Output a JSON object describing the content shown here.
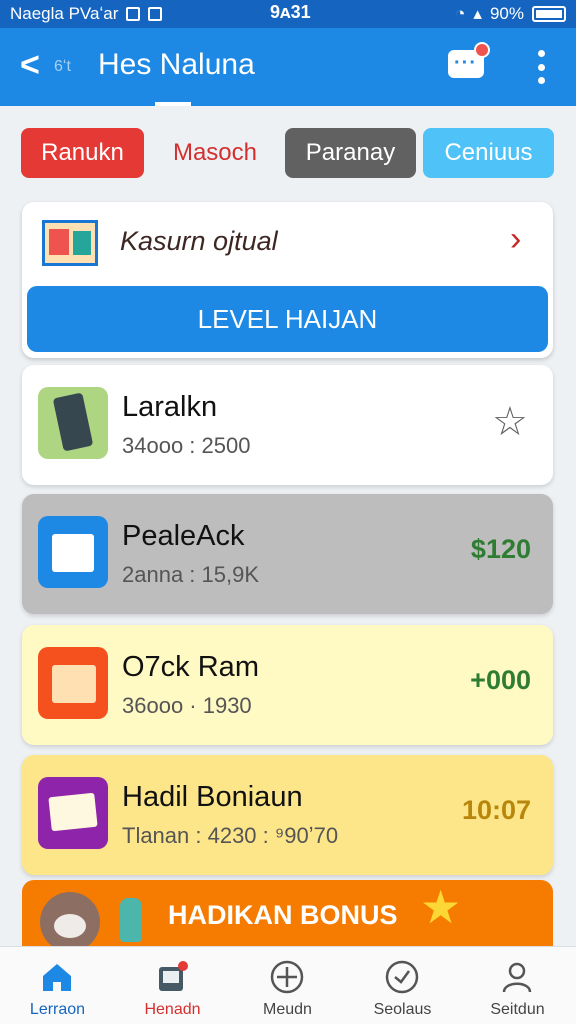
{
  "status_bar": {
    "carrier": "Naegla PVaʻar",
    "time": "9ᴀ31",
    "battery": "90%"
  },
  "app_bar": {
    "back_sub": "6ʻt",
    "title": "Hes Naluna"
  },
  "chips": [
    "Ranukn",
    "Masoch",
    "Paranay",
    "Ceniuus"
  ],
  "promo": {
    "text": "Kasurn ojtual",
    "button": "LEVEL HAIJAN"
  },
  "items": [
    {
      "name": "Laralkn",
      "sub": "34ooo : 2500",
      "value": ""
    },
    {
      "name": "PealeAck",
      "sub": "2anna : 15,9K",
      "value": "$120"
    },
    {
      "name": "O7ck Ram",
      "sub": "36ooo · 1930",
      "value": "+000"
    },
    {
      "name": "Hadil Boniaun",
      "sub": "Tlanan : 4230 : ⁹90ʼ70",
      "value": "10:07"
    }
  ],
  "bonus": {
    "text": "HADIKAN BONUS"
  },
  "bottom_nav": [
    "Lerraon",
    "Henadn",
    "Meudn",
    "Seolaus",
    "Seitdun"
  ],
  "colors": {
    "primary": "#1e88e5",
    "status": "#1565c0",
    "accent_red": "#e53935",
    "bonus": "#f57c00"
  },
  "icons": [
    "back-chevron-icon",
    "chat-icon",
    "more-vert-icon",
    "star-icon",
    "home-icon",
    "inbox-icon",
    "add-circle-icon",
    "dial-icon",
    "person-icon"
  ]
}
